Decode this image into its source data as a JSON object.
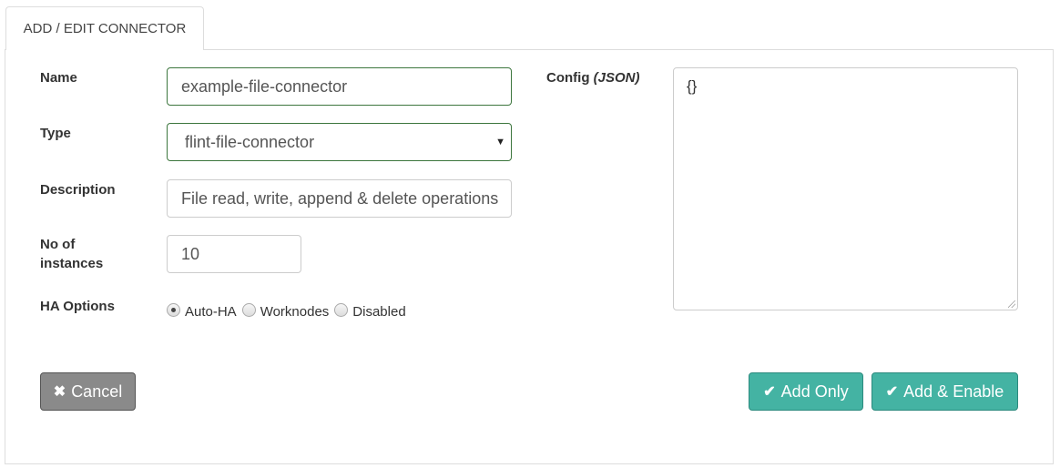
{
  "tab": {
    "label": "ADD / EDIT CONNECTOR"
  },
  "form": {
    "name": {
      "label": "Name",
      "value": "example-file-connector"
    },
    "type": {
      "label": "Type",
      "value": "flint-file-connector"
    },
    "description": {
      "label": "Description",
      "value": "File read, write, append & delete operations"
    },
    "instances": {
      "label_line1": "No of",
      "label_line2": "instances",
      "value": "10"
    },
    "ha": {
      "label": "HA Options",
      "options": [
        "Auto-HA",
        "Worknodes",
        "Disabled"
      ],
      "selected": "Auto-HA"
    },
    "config": {
      "label": "Config",
      "label_suffix": "(JSON)",
      "value": "{}"
    }
  },
  "buttons": {
    "cancel": "Cancel",
    "add_only": "Add Only",
    "add_enable": "Add & Enable"
  },
  "colors": {
    "accent": "#44b3a3",
    "cancel": "#8a8a8a",
    "valid_border": "#3c763d"
  },
  "icons": {
    "cancel": "close-icon",
    "confirm": "check-icon",
    "select": "caret-down-icon"
  }
}
